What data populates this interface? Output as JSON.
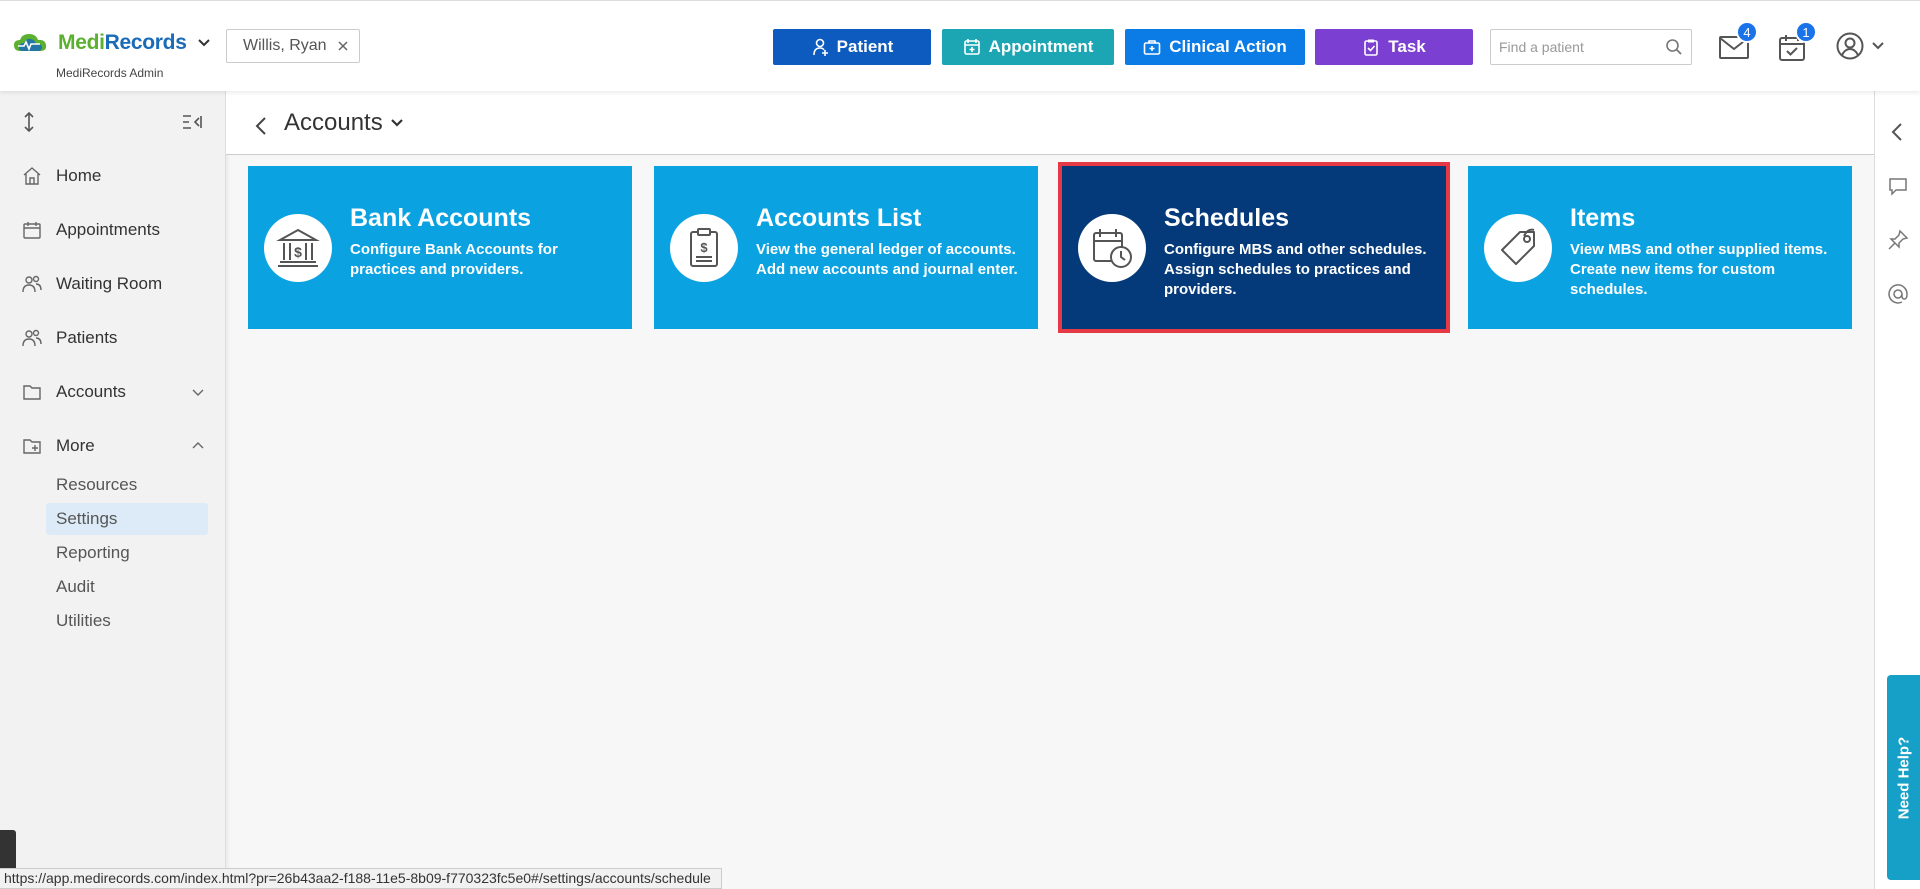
{
  "header": {
    "logo_medi": "Medi",
    "logo_records": "Records",
    "logo_sub": "MediRecords Admin",
    "patient_chip": "Willis, Ryan",
    "buttons": {
      "patient": "Patient",
      "appointment": "Appointment",
      "clinical": "Clinical Action",
      "task": "Task"
    },
    "search_placeholder": "Find a patient",
    "mail_badge": "4",
    "task_badge": "1"
  },
  "sidebar": {
    "items": {
      "home": "Home",
      "appointments": "Appointments",
      "waiting_room": "Waiting Room",
      "patients": "Patients",
      "accounts": "Accounts",
      "more": "More"
    },
    "sub_items": {
      "resources": "Resources",
      "settings": "Settings",
      "reporting": "Reporting",
      "audit": "Audit",
      "utilities": "Utilities"
    }
  },
  "page": {
    "title": "Accounts"
  },
  "tiles": {
    "bank": {
      "title": "Bank Accounts",
      "desc": "Configure Bank Accounts for practices and providers."
    },
    "list": {
      "title": "Accounts List",
      "desc": "View the general ledger of accounts. Add new accounts and journal enter."
    },
    "schedules": {
      "title": "Schedules",
      "desc": "Configure MBS and other schedules. Assign schedules to practices and providers."
    },
    "items": {
      "title": "Items",
      "desc": "View MBS and other supplied items. Create new items for custom schedules."
    }
  },
  "need_help": "Need Help?",
  "status_url": "https://app.medirecords.com/index.html?pr=26b43aa2-f188-11e5-8b09-f770323fc5e0#/settings/accounts/schedule",
  "colors": {
    "tile": "#0aa2e0",
    "tile_selected": "#053a7a",
    "highlight": "#e63946",
    "patient_btn": "#0d5bbf",
    "appointment_btn": "#1ca6b4",
    "clinical_btn": "#0b7ce6",
    "task_btn": "#7b3fd1"
  },
  "icons": [
    "logo-cloud-icon",
    "chevron-down-icon",
    "close-icon",
    "add-user-icon",
    "calendar-plus-icon",
    "medical-kit-icon",
    "clipboard-check-icon",
    "search-icon",
    "mail-icon",
    "calendar-check-icon",
    "user-circle-icon",
    "expand-vertical-icon",
    "collapse-sidebar-icon",
    "home-icon",
    "calendar-icon",
    "people-icon",
    "folder-icon",
    "folder-plus-icon",
    "chevron-up-icon",
    "chevron-left-icon",
    "bank-icon",
    "clipboard-dollar-icon",
    "calendar-clock-icon",
    "tag-icon",
    "chat-icon",
    "pin-icon",
    "at-icon"
  ]
}
